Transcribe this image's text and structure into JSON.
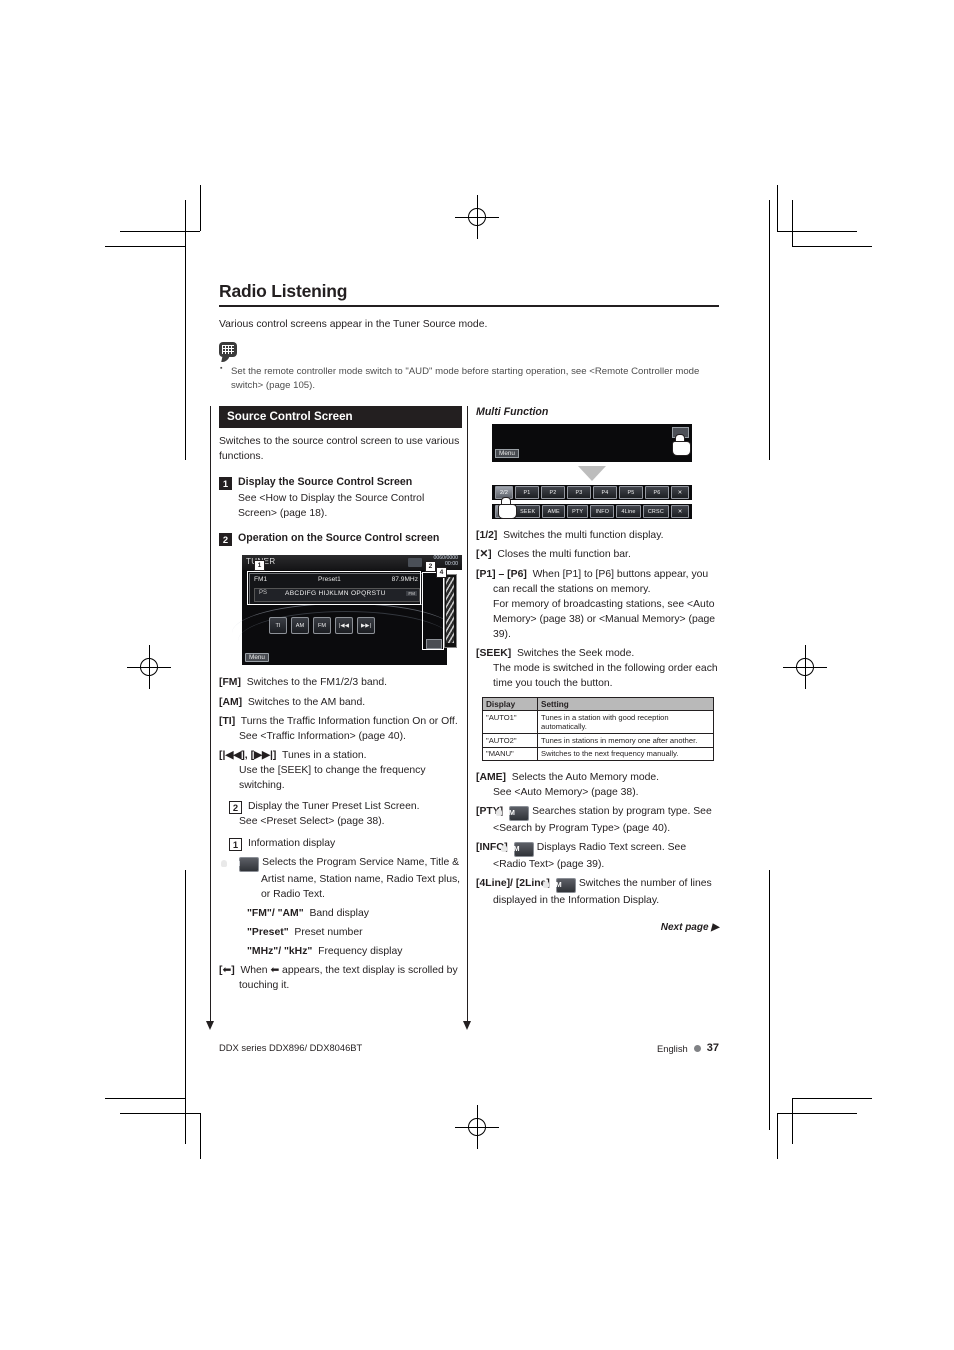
{
  "header": {
    "title": "Radio Listening",
    "intro": "Various control screens appear in the Tuner Source mode.",
    "note": "Set the remote controller mode switch to \"AUD\" mode before starting operation, see <Remote Controller mode switch> (page 105)."
  },
  "left": {
    "section_title": "Source Control Screen",
    "section_body": "Switches to the source control screen to use various functions.",
    "step1": {
      "num": "1",
      "title": "Display the Source Control Screen",
      "sub": "See <How to Display the Source Control Screen> (page 18)."
    },
    "step2": {
      "num": "2",
      "title": "Operation on the Source Control screen"
    },
    "device_screen": {
      "source": "TUNER",
      "clock_line1": "0060/0000",
      "clock_line2": "00:00",
      "band": "FM1",
      "preset": "Preset1",
      "frequency": "87.9MHz",
      "ps_label": "PS",
      "radio_text": "ABCDIFG HIJKLMN OPQRSTU",
      "fm_tag": "FM",
      "menu": "Menu",
      "keys": [
        "TI",
        "AM",
        "FM",
        "|◀◀",
        "▶▶|"
      ],
      "callouts": [
        "1",
        "2",
        "4"
      ]
    },
    "bullets": [
      {
        "key": "[FM]",
        "text": "Switches to the FM1/2/3 band."
      },
      {
        "key": "[AM]",
        "text": "Switches to the AM band."
      },
      {
        "key": "[TI]",
        "text": "Turns the Traffic Information function On or Off.",
        "cont": [
          "See <Traffic Information> (page 40)."
        ]
      },
      {
        "key": "[|◀◀], [▶▶|]",
        "text": "Tunes in a station.",
        "cont": [
          "Use the [SEEK] to change the frequency switching."
        ]
      }
    ],
    "numbered": [
      {
        "num": "2",
        "text": "Display the Tuner Preset List Screen.",
        "cont": [
          "See <Preset Select> (page 38)."
        ]
      },
      {
        "num": "1",
        "text": "Information display"
      }
    ],
    "info_items": [
      {
        "badge": "FM",
        "text": "Selects the Program Service Name, Title & Artist name, Station name, Radio Text plus, or Radio Text."
      },
      {
        "key": "\"FM\"/ \"AM\"",
        "text": "Band display"
      },
      {
        "key": "\"Preset\"",
        "text": "Preset number"
      },
      {
        "key": "\"MHz\"/ \"kHz\"",
        "text": "Frequency display"
      }
    ],
    "scroll_note_pre": "[",
    "scroll_note_post": "]",
    "scroll_note": "When ⬅ appears, the text display is scrolled by touching it."
  },
  "right": {
    "mf_title": "Multi Function",
    "mf_top_menu": "Menu",
    "bar_page2": [
      "2/2",
      "P1",
      "P2",
      "P3",
      "P4",
      "P5",
      "P6",
      "✕"
    ],
    "bar_page1": [
      "1/2",
      "SEEK",
      "AME",
      "PTY",
      "INFO",
      "4Line",
      "CRSC",
      "✕"
    ],
    "bullets": [
      {
        "key": "[1/2]",
        "text": "Switches the multi function display."
      },
      {
        "key": "[✕]",
        "text": "Closes the multi function bar."
      },
      {
        "key": "[P1] – [P6]",
        "text": "When [P1] to [P6] buttons appear, you can recall the stations on memory.",
        "cont": [
          "For memory of broadcasting stations, see <Auto Memory> (page 38) or <Manual Memory> (page 39)."
        ]
      },
      {
        "key": "[SEEK]",
        "text": "Switches the Seek mode.",
        "cont": [
          "The mode is switched in the following order each time you touch the button."
        ]
      }
    ],
    "seek_table": {
      "headers": [
        "Display",
        "Setting"
      ],
      "rows": [
        [
          "\"AUTO1\"",
          "Tunes in a station with good reception automatically."
        ],
        [
          "\"AUTO2\"",
          "Tunes in stations in memory one after another."
        ],
        [
          "\"MANU\"",
          "Switches to the next frequency manually."
        ]
      ]
    },
    "bullets2": [
      {
        "key": "[AME]",
        "text": "Selects the Auto Memory mode.",
        "cont": [
          "See <Auto Memory> (page 38)."
        ]
      },
      {
        "key": "[PTY]",
        "badge": "FM",
        "text": "Searches station by program type. See <Search by Program Type> (page 40)."
      },
      {
        "key": "[INFO]",
        "badge": "FM",
        "text": "Displays Radio Text screen. See <Radio Text> (page 39)."
      },
      {
        "key": "[4Line]/ [2Line]",
        "badge": "FM",
        "text": "Switches the number of lines displayed in the Information Display."
      }
    ],
    "next_page": "Next page ▶"
  },
  "footer": {
    "model": "DDX series   DDX896/ DDX8046BT",
    "language": "English",
    "page": "37"
  }
}
